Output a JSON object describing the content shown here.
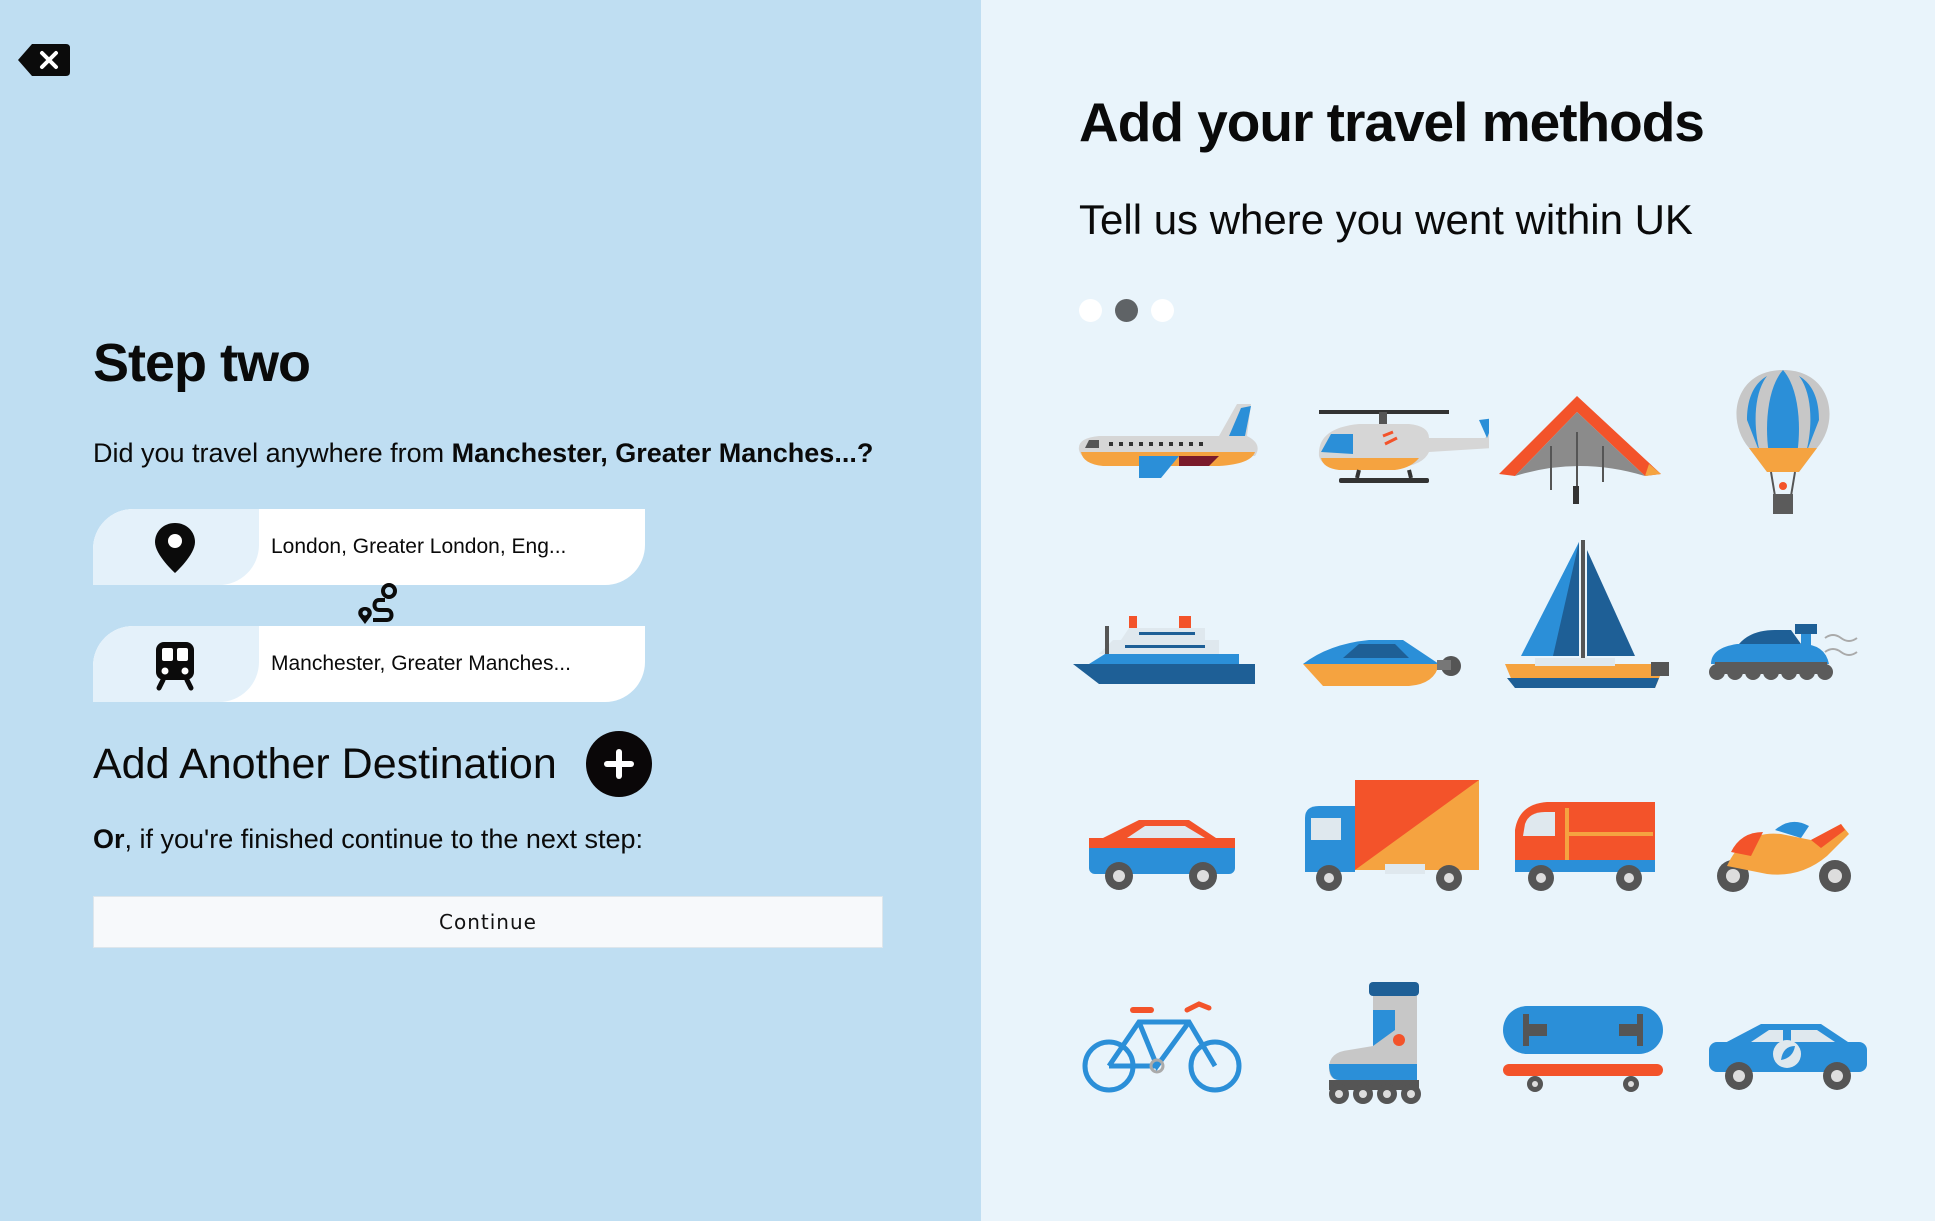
{
  "step": {
    "title": "Step two",
    "question_prefix": "Did you travel anywhere from ",
    "question_place": "Manchester, Greater Manches...",
    "question_suffix": "?"
  },
  "destinations": [
    {
      "label": "London, Greater London, Eng...",
      "icon": "location-pin-icon"
    },
    {
      "label": "Manchester, Greater Manches...",
      "icon": "train-icon"
    }
  ],
  "add_destination": {
    "label": "Add Another Destination",
    "icon": "plus-icon"
  },
  "finished": {
    "bold": "Or",
    "text": ", if you're finished continue to the next step:"
  },
  "continue_label": "Continue",
  "methods": {
    "title": "Add your travel methods",
    "subtitle": "Tell us where you went within UK",
    "pagination": {
      "total": 3,
      "active": 2
    },
    "vehicles": [
      "airplane-icon",
      "helicopter-icon",
      "hang-glider-icon",
      "hot-air-balloon-icon",
      "cruise-ship-icon",
      "speedboat-icon",
      "sailboat-icon",
      "hovercraft-icon",
      "car-icon",
      "truck-icon",
      "van-icon",
      "motorbike-icon",
      "bicycle-icon",
      "rollerblade-icon",
      "skateboard-icon",
      "electric-car-icon"
    ]
  },
  "colors": {
    "left_bg": "#bfdef2",
    "right_bg": "#e9f4fb",
    "blue": "#2b8fd8",
    "orange": "#f3532a",
    "light_orange": "#f5a340",
    "dark": "#2d2f33"
  }
}
